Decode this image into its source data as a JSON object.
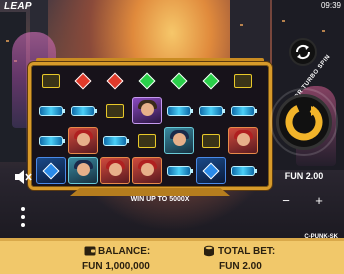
{
  "header": {
    "logo_text": "LEAP",
    "clock": "09:39"
  },
  "controls": {
    "hold_text": "HOLD FOR TURBO SPIN",
    "bet_amount": "FUN 2.00",
    "minus_label": "−",
    "plus_label": "+"
  },
  "promo": {
    "win_text": "WIN UP TO 5000X"
  },
  "footer": {
    "balance_label": "BALANCE:",
    "balance_value": "FUN 1,000,000",
    "total_bet_label": "TOTAL BET:",
    "total_bet_value": "FUN 2.00",
    "game_code": "C-PUNK-SK"
  },
  "reels": [
    [
      "chip-yellow",
      "battery",
      "battery",
      "gem-blue"
    ],
    [
      "gem-red",
      "battery",
      "face-red",
      "face-teal"
    ],
    [
      "gem-red",
      "chip-yellow",
      "battery",
      "face-red"
    ],
    [
      "gem-green",
      "face-purple",
      "chip-yellow",
      "face-red"
    ],
    [
      "gem-green",
      "battery",
      "face-teal",
      "battery"
    ],
    [
      "gem-green",
      "battery",
      "chip-yellow",
      "gem-blue"
    ],
    [
      "chip-yellow",
      "battery",
      "face-red",
      "battery"
    ]
  ],
  "colors": {
    "accent": "#f1c86a",
    "frame": "#d79a2a",
    "spin": "#f2b42a"
  },
  "icons": {
    "autoplay": "autoplay-icon",
    "spin": "spin-icon",
    "sound": "sound-off-icon",
    "menu": "menu-icon",
    "balance": "wallet-icon",
    "bet": "coins-icon"
  }
}
